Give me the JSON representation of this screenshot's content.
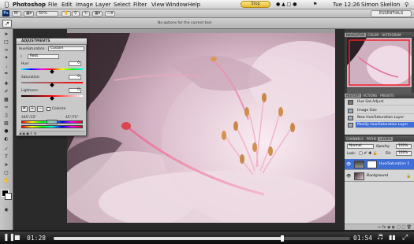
{
  "menubar": {
    "apple": "",
    "items": [
      "Photoshop",
      "File",
      "Edit",
      "Image",
      "Layer",
      "Select",
      "Filter",
      "View",
      "Window",
      "Help"
    ],
    "skype_status": "Stop Recording",
    "clock": "Tue 12:26",
    "user": "Simon Skellon"
  },
  "options_bar": {
    "zoom": "50%",
    "workspace": "ESSENTIALS",
    "hint": "No options for the current tool"
  },
  "adjustments": {
    "panel_title": "ADJUSTMENTS",
    "adjustment_name": "Hue/Saturation",
    "preset": "Custom",
    "channel": "Reds",
    "hue_label": "Hue:",
    "hue_value": "0",
    "saturation_label": "Saturation:",
    "saturation_value": "0",
    "lightness_label": "Lightness:",
    "lightness_value": "0",
    "colorize_label": "Colorize",
    "range_left": "345°/15°",
    "range_right": "45°/75°",
    "hue_level": 0.5,
    "saturation_level": 0.5,
    "lightness_level": 0.5
  },
  "navigator": {
    "tabs": [
      "NAVIGATOR",
      "COLOR",
      "HISTOGRAM"
    ]
  },
  "history": {
    "tabs": [
      "HISTORY",
      "ACTIONS",
      "PRESETS"
    ],
    "snapshot": "Hue Sat.Adjust",
    "items": [
      "Image Size",
      "New Hue/Saturation Layer",
      "Modify Hue/Saturation Layer"
    ],
    "selected_index": 2
  },
  "layers": {
    "tabs": [
      "CHANNELS",
      "PATHS",
      "LAYERS"
    ],
    "blend_mode": "Normal",
    "opacity_label": "Opacity:",
    "opacity": "100%",
    "lock_label": "Lock:",
    "fill_label": "Fill:",
    "fill": "100%",
    "items": [
      "Hue/Saturation 1",
      "Background"
    ]
  },
  "video": {
    "elapsed": "01:28",
    "total": "01:54",
    "progress": 0.77
  }
}
